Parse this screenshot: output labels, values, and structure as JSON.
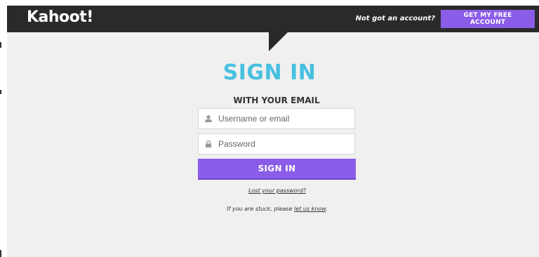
{
  "header": {
    "logo_text": "Kahoot!",
    "account_prompt": "Not got an account?",
    "free_account_label": "GET MY FREE ACCOUNT"
  },
  "signin": {
    "title": "SIGN IN",
    "subtitle": "WITH YOUR EMAIL",
    "username_placeholder": "Username or email",
    "password_placeholder": "Password",
    "button_label": "SIGN IN",
    "lost_password_label": "Lost your password?",
    "stuck_prefix": "If you are stuck, please ",
    "stuck_link": "let us know",
    "stuck_suffix": "."
  },
  "colors": {
    "header_bg": "#2a2a2a",
    "accent_purple": "#8a5ce8",
    "title_blue": "#48c0e0",
    "page_bg": "#f0f0f0"
  },
  "icons": {
    "username": "user-icon",
    "password": "lock-icon"
  }
}
